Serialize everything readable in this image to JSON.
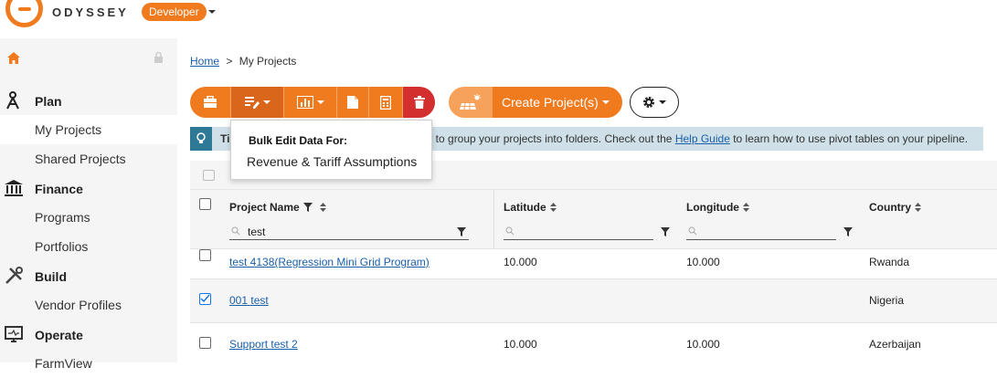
{
  "app": {
    "name": "ODYSSEY",
    "environment": "Developer"
  },
  "sidebar": {
    "sections": [
      {
        "label": "Plan",
        "icon": "plan-icon",
        "items": [
          "My Projects",
          "Shared Projects"
        ]
      },
      {
        "label": "Finance",
        "icon": "bank-icon",
        "items": [
          "Programs",
          "Portfolios"
        ]
      },
      {
        "label": "Build",
        "icon": "tools-icon",
        "items": [
          "Vendor Profiles"
        ]
      },
      {
        "label": "Operate",
        "icon": "monitor-icon",
        "items": [
          "FarmView"
        ]
      }
    ],
    "active_item": "My Projects"
  },
  "breadcrumb": {
    "home": "Home",
    "separator": ">",
    "current": "My Projects"
  },
  "toolbar": {
    "create_label": "Create Project(s)",
    "colors": {
      "primary": "#f07b1f",
      "danger": "#d32f2f"
    }
  },
  "tip": {
    "label": "Tip",
    "text": "ow to group your projects into folders. Check out the ",
    "link": "Help Guide",
    "text_after": " to learn how to use pivot tables on your pipeline."
  },
  "dropdown": {
    "heading": "Bulk Edit Data For:",
    "item": "Revenue & Tariff Assumptions"
  },
  "table": {
    "columns": [
      "Project Name",
      "Latitude",
      "Longitude",
      "Country"
    ],
    "filters": {
      "project_name": "test",
      "latitude": "",
      "longitude": "",
      "country": ""
    },
    "rows": [
      {
        "name": "test 4138(Regression Mini Grid Program)",
        "latitude": "10.000",
        "longitude": "10.000",
        "country": "Rwanda",
        "checked": false
      },
      {
        "name": "001 test",
        "latitude": "",
        "longitude": "",
        "country": "Nigeria",
        "checked": true
      },
      {
        "name": "Support test 2",
        "latitude": "10.000",
        "longitude": "10.000",
        "country": "Azerbaijan",
        "checked": false
      }
    ]
  }
}
